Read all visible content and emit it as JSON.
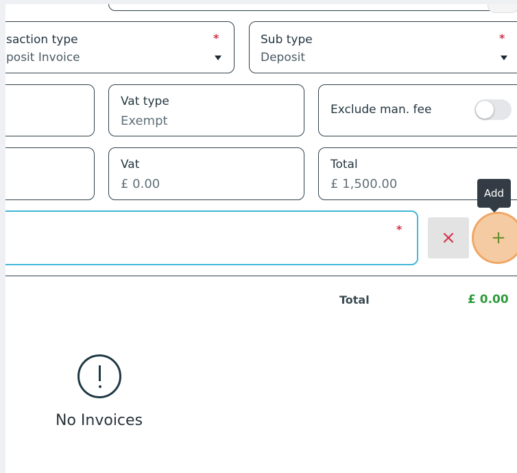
{
  "fields": {
    "transaction_type": {
      "label": "saction type",
      "value": "posit Invoice"
    },
    "sub_type": {
      "label": "Sub type",
      "value": "Deposit"
    },
    "vat_type": {
      "label": "Vat type",
      "value": "Exempt"
    },
    "exclude_fee": {
      "label": "Exclude man. fee",
      "checked": false
    },
    "vat": {
      "label": "Vat",
      "value": "£ 0.00"
    },
    "total": {
      "label": "Total",
      "value": "£ 1,500.00"
    },
    "required_marker": "*"
  },
  "actions": {
    "clear_glyph": "×",
    "add_glyph": "+",
    "add_tooltip": "Add"
  },
  "summary": {
    "total_label": "Total",
    "total_value": "£ 0.00"
  },
  "empty_state": {
    "icon": "exclamation-circle-icon",
    "message": "No Invoices"
  },
  "colors": {
    "accent_focus": "#3fb7d6",
    "clear": "#d2334a",
    "add": "#6a8f2a",
    "total_green": "#2e9b3c",
    "highlight": "#f0a35e"
  }
}
